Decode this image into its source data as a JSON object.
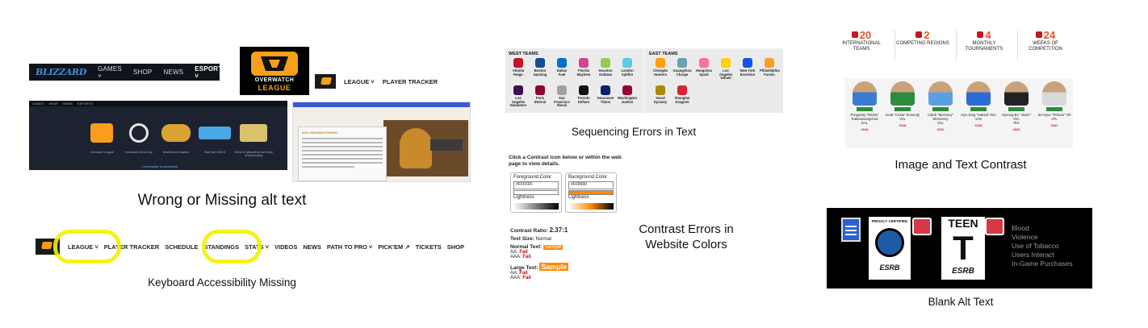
{
  "captions": {
    "alt_text": "Wrong or Missing alt text",
    "keyboard": "Keyboard Accessibility Missing",
    "sequencing": "Sequencing Errors in Text",
    "contrast_colors": "Contrast Errors in Website Colors",
    "image_text_contrast": "Image and Text Contrast",
    "blank_alt": "Blank Alt Text"
  },
  "blizzard_nav": {
    "logo": "BLIZZARD",
    "items": [
      "GAMES ˅",
      "SHOP",
      "NEWS",
      "ESPORTS ˅"
    ]
  },
  "owl_logo": {
    "line1": "OVERWATCH",
    "line2": "LEAGUE"
  },
  "league_nav": {
    "items": [
      "LEAGUE ˅",
      "PLAYER TRACKER"
    ]
  },
  "esports_shot": {
    "top_items": [
      "GAMES",
      "SHOP",
      "NEWS",
      "ESPORTS"
    ],
    "tiles": [
      {
        "caption": "Overwatch League",
        "color": "#f99e1a"
      },
      {
        "caption": "Overwatch World Cup",
        "color": "#e8e8e8"
      },
      {
        "caption": "Hearthstone Masters",
        "color": "#d9a233"
      },
      {
        "caption": "StarCraft II WCS",
        "color": "#4aa8e6"
      },
      {
        "caption": "World of Warcraft Arena World Championship",
        "color": "#d9c26b"
      }
    ],
    "community": "Community Tournaments"
  },
  "ow_shot": {
    "card_title": "2021 SEASON FORMAT"
  },
  "keyboard_nav": {
    "items": [
      "LEAGUE ˅",
      "PLAYER TRACKER",
      "SCHEDULE",
      "STANDINGS",
      "STATS ˅",
      "VIDEOS",
      "NEWS",
      "PATH TO PRO ˅",
      "PICK'EM ↗",
      "TICKETS",
      "SHOP"
    ]
  },
  "teams": {
    "west_label": "WEST TEAMS",
    "east_label": "EAST TEAMS",
    "west": [
      {
        "city": "Atlanta",
        "name": "Reign",
        "color": "#c8102e"
      },
      {
        "city": "Boston",
        "name": "Uprising",
        "color": "#174b97"
      },
      {
        "city": "Dallas",
        "name": "Fuel",
        "color": "#0072ce"
      },
      {
        "city": "Florida",
        "name": "Mayhem",
        "color": "#cf4691"
      },
      {
        "city": "Houston",
        "name": "Outlaws",
        "color": "#96ca4e"
      },
      {
        "city": "London",
        "name": "Spitfire",
        "color": "#59cbe8"
      },
      {
        "city": "Los Angeles",
        "name": "Gladiators",
        "color": "#3c1053"
      },
      {
        "city": "Paris",
        "name": "Eternal",
        "color": "#8d042d"
      },
      {
        "city": "San Francisco",
        "name": "Shock",
        "color": "#a0a0a0"
      },
      {
        "city": "Toronto",
        "name": "Defiant",
        "color": "#111111"
      },
      {
        "city": "Vancouver",
        "name": "Titans",
        "color": "#09226b"
      },
      {
        "city": "Washington",
        "name": "Justice",
        "color": "#990034"
      }
    ],
    "east": [
      {
        "city": "Chengdu",
        "name": "Hunters",
        "color": "#ffa000"
      },
      {
        "city": "Guangzhou",
        "name": "Charge",
        "color": "#67a2b2"
      },
      {
        "city": "Hangzhou",
        "name": "Spark",
        "color": "#fb7299"
      },
      {
        "city": "Los Angeles",
        "name": "Valiant",
        "color": "#ffd100"
      },
      {
        "city": "New York",
        "name": "Excelsior",
        "color": "#0f57ea"
      },
      {
        "city": "Philadelphia",
        "name": "Fusion",
        "color": "#f99e29"
      },
      {
        "city": "Seoul",
        "name": "Dynasty",
        "color": "#aa8a00"
      },
      {
        "city": "Shanghai",
        "name": "Dragons",
        "color": "#d22630"
      }
    ]
  },
  "contrast_checker": {
    "heading": "Click a Contrast icon below or within the web page to view details.",
    "fg_label": "Foreground Color",
    "bg_label": "Background Color",
    "fg_value": "#FFFFFF",
    "bg_value": "#FF8900",
    "lightness": "Lightness",
    "ratio_label": "Contrast Ratio:",
    "ratio_value": "2.37:1",
    "text_size_label": "Text Size:",
    "text_size_value": "Normal",
    "normal_label": "Normal Text:",
    "large_label": "Large Text:",
    "sample": "Sample",
    "aa": "AA:",
    "aaa": "AAA:",
    "fail": "Fail",
    "fg_color": "#FFFFFF",
    "bg_color": "#FF8900"
  },
  "stats": [
    {
      "num": "20",
      "label": "INTERNATIONAL TEAMS"
    },
    {
      "num": "2",
      "label": "COMPETING REGIONS"
    },
    {
      "num": "4",
      "label": "MONTHLY TOURNAMENTS"
    },
    {
      "num": "24",
      "label": "WEEKS OF COMPETITION"
    }
  ],
  "players": [
    {
      "name": "Pongphop \"Mickie\" Rattanasangchod",
      "team": "DAL",
      "year": "2018",
      "color": "#3a7bd5"
    },
    {
      "name": "Scott \"Custa\" Kennedy",
      "team": "VAL",
      "year": "2018",
      "color": "#2d8a3e"
    },
    {
      "name": "Caleb \"McGravy\" McGarvey",
      "team": "VAL",
      "year": "2020",
      "color": "#5aa0e0"
    },
    {
      "name": "Hyo-Jong \"Haksal\" Kim",
      "team": "VAN",
      "year": "2018",
      "color": "#2c6bd4"
    },
    {
      "name": "Hyeong-Bo \"Alarm\" Kim",
      "team": "PHI",
      "year": "2020",
      "color": "#222222"
    },
    {
      "name": "Se-Hyun \"Pelican\" Oh",
      "team": "ATL",
      "year": "2021",
      "color": "#d9d9d9"
    }
  ],
  "ratings": {
    "teen": "TEEN",
    "t": "T",
    "esrb": "ESRB",
    "privacy": "PRIVACY CERTIFIED",
    "descriptors": [
      "Blood",
      "Violence",
      "Use of Tobacco",
      "Users Interact",
      "In-Game Purchases"
    ]
  }
}
